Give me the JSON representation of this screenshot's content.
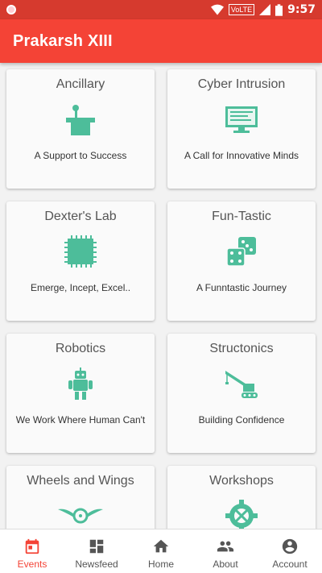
{
  "status": {
    "time": "9:57",
    "volte": "VoLTE",
    "icons": [
      "notification-icon",
      "wifi-icon",
      "signal-icon",
      "battery-icon"
    ]
  },
  "app": {
    "title": "Prakarsh XIII",
    "primary_color": "#f44336",
    "accent_color": "#4dbd9a"
  },
  "cards": [
    {
      "title": "Ancillary",
      "subtitle": "A Support to Success",
      "icon": "podium-icon"
    },
    {
      "title": "Cyber Intrusion",
      "subtitle": "A Call for Innovative Minds",
      "icon": "computer-icon"
    },
    {
      "title": "Dexter's Lab",
      "subtitle": "Emerge, Incept, Excel..",
      "icon": "chip-icon"
    },
    {
      "title": "Fun-Tastic",
      "subtitle": "A Funntastic Journey",
      "icon": "dice-icon"
    },
    {
      "title": "Robotics",
      "subtitle": "We Work Where Human Can't",
      "icon": "robot-icon"
    },
    {
      "title": "Structonics",
      "subtitle": "Building Confidence",
      "icon": "crane-icon"
    },
    {
      "title": "Wheels and Wings",
      "subtitle": "",
      "icon": "winged-wheel-icon"
    },
    {
      "title": "Workshops",
      "subtitle": "",
      "icon": "tools-gear-icon"
    }
  ],
  "nav": [
    {
      "label": "Events",
      "icon": "events-icon",
      "active": true
    },
    {
      "label": "Newsfeed",
      "icon": "dashboard-icon",
      "active": false
    },
    {
      "label": "Home",
      "icon": "home-icon",
      "active": false
    },
    {
      "label": "About",
      "icon": "people-icon",
      "active": false
    },
    {
      "label": "Account",
      "icon": "account-icon",
      "active": false
    }
  ]
}
